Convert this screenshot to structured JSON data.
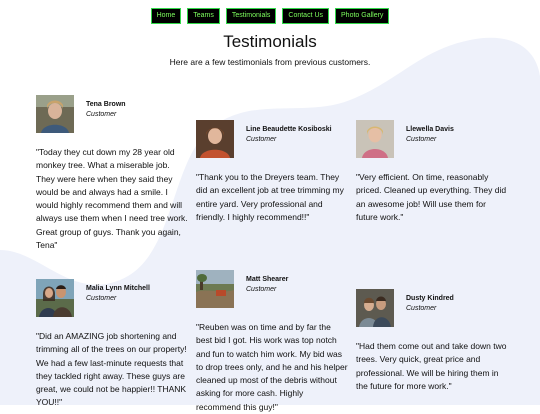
{
  "nav": {
    "items": [
      {
        "label": "Home"
      },
      {
        "label": "Teams"
      },
      {
        "label": "Testimonials"
      },
      {
        "label": "Contact Us"
      },
      {
        "label": "Photo Gallery"
      }
    ]
  },
  "colors": {
    "nav_bg": "#000000",
    "nav_text": "#7dff5e",
    "blob": "#eef1fa"
  },
  "page": {
    "title": "Testimonials",
    "subtitle": "Here are a few testimonials from previous customers."
  },
  "testimonials": [
    {
      "name": "Tena Brown",
      "role": "Customer",
      "quote": "\"Today they cut down my 28 year old monkey tree. What a miserable job. They were here when they said they would be and always had a smile. I would highly recommend them and will always use them when I need tree work. Great group of guys. Thank you again, Tena\""
    },
    {
      "name": "Line Beaudette Kosiboski",
      "role": "Customer",
      "quote": "\"Thank you to the Dreyers team. They did an excellent job at tree trimming my entire yard. Very professional and friendly. I highly recommend!!\""
    },
    {
      "name": "Llewella Davis",
      "role": "Customer",
      "quote": "\"Very efficient. On time, reasonably priced. Cleaned up everything. They did an awesome job! Will use them for future work.\""
    },
    {
      "name": "Malia Lynn Mitchell",
      "role": "Customer",
      "quote": "\"Did an AMAZING job shortening and trimming all of the trees on our property! We had a few last-minute requests that they tackled right away. These guys are great, we could not be happier!! THANK YOU!!\""
    },
    {
      "name": "Matt Shearer",
      "role": "Customer",
      "quote": "\"Reuben was on time and by far the best bid I got. His work was top notch and fun to watch him work. My bid was to drop trees only, and he and his helper cleaned up most of the debris without asking for more cash. Highly recommend this guy!\""
    },
    {
      "name": "Dusty Kindred",
      "role": "Customer",
      "quote": "\"Had them come out and take down two trees. Very quick, great price and professional. We will be hiring them in the future for more work.\""
    }
  ]
}
